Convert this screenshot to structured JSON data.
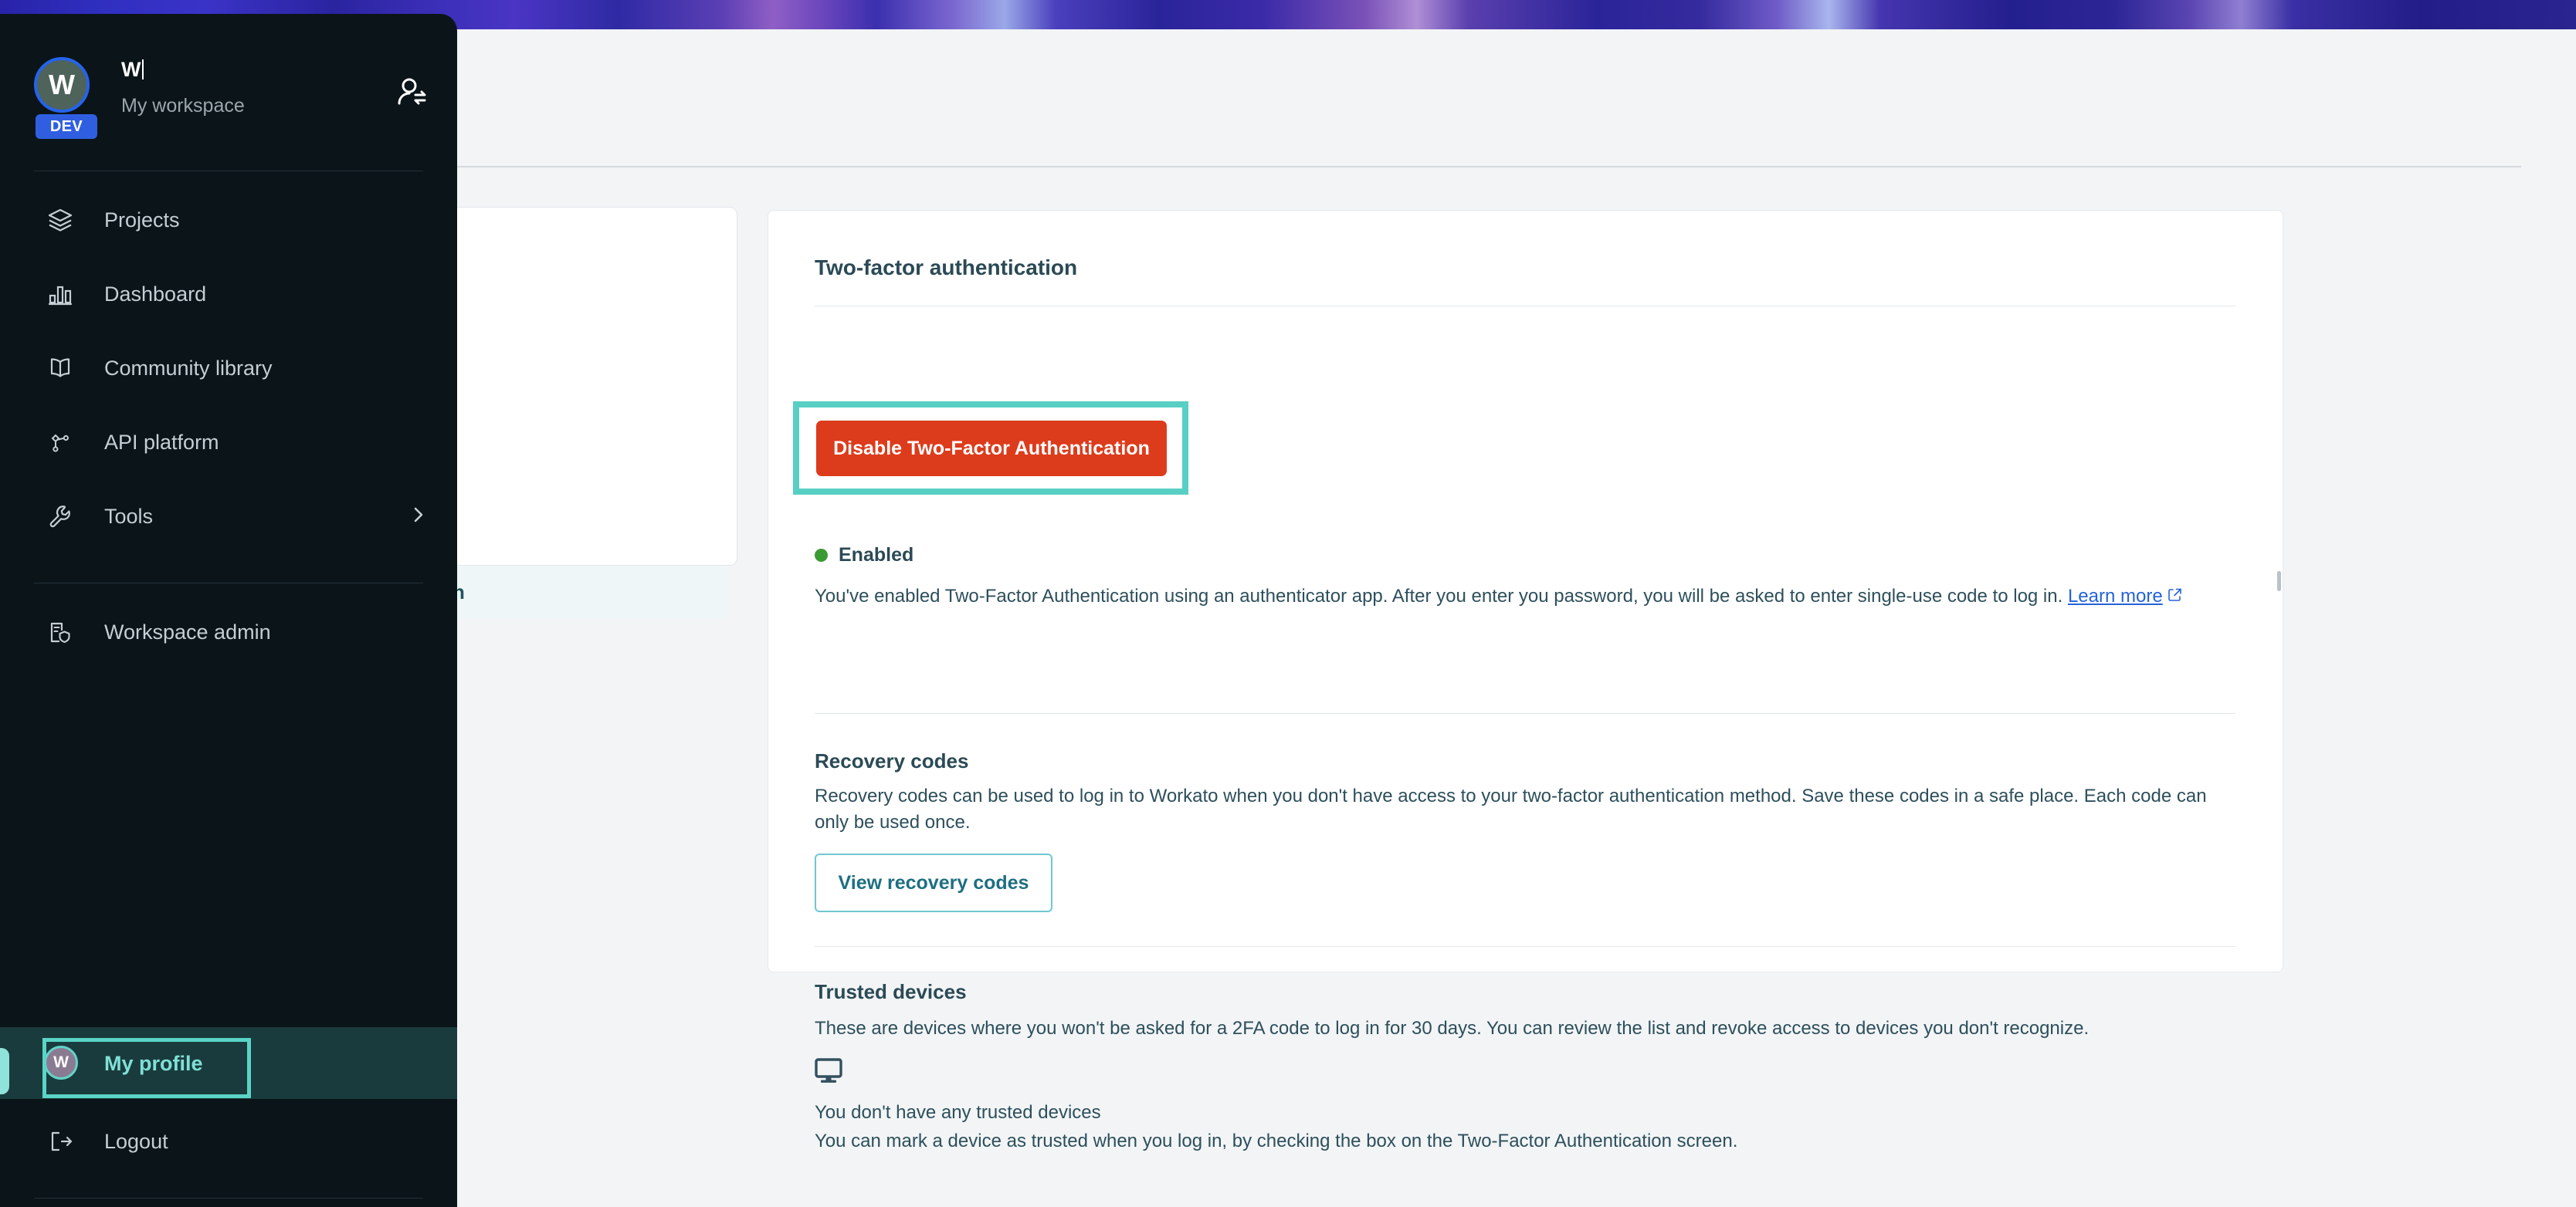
{
  "sidebar": {
    "workspace": {
      "avatar_initial": "W",
      "badge": "DEV",
      "name": "W",
      "subtitle": "My workspace",
      "switch_icon": "switch-user-icon"
    },
    "nav_items": [
      {
        "label": "Projects",
        "icon": "layers-icon"
      },
      {
        "label": "Dashboard",
        "icon": "bar-chart-icon"
      },
      {
        "label": "Community library",
        "icon": "book-icon"
      },
      {
        "label": "API platform",
        "icon": "nodes-icon"
      },
      {
        "label": "Tools",
        "icon": "wrench-icon",
        "chevron": "chevron-right-icon"
      }
    ],
    "admin_item": {
      "label": "Workspace admin",
      "icon": "building-shield-icon"
    },
    "profile_item": {
      "label": "My profile",
      "avatar_initial": "W",
      "highlighted": true
    },
    "logout_item": {
      "label": "Logout",
      "icon": "logout-icon"
    }
  },
  "settings_nav": {
    "active_item_partial": "n"
  },
  "main": {
    "panel_title": "Two-factor authentication",
    "status": {
      "label": "Enabled",
      "dot_color": "#3c9a34"
    },
    "description": "You've enabled Two-Factor Authentication using an authenticator app. After you enter you password, you will be asked to enter single-use code to log in.",
    "learn_more": "Learn more",
    "disable_button": "Disable Two-Factor Authentication",
    "recovery": {
      "title": "Recovery codes",
      "description": "Recovery codes can be used to log in to Workato when you don't have access to your two-factor authentication method. Save these codes in a safe place. Each code can only be used once.",
      "button": "View recovery codes"
    },
    "trusted_devices": {
      "title": "Trusted devices",
      "description": "These are devices where you won't be asked for a 2FA code to log in for 30 days. You can review the list and revoke access to devices you don't recognize.",
      "icon": "monitor-icon",
      "empty_title": "You don't have any trusted devices",
      "empty_subtitle": "You can mark a device as trusted when you log in, by checking the box on the Two-Factor Authentication screen."
    }
  },
  "colors": {
    "danger": "#dc3c1c",
    "highlight": "#58cfc4",
    "link": "#2563d8",
    "sidebar_bg": "#0b1418",
    "teal_accent": "#7fe0d6"
  }
}
